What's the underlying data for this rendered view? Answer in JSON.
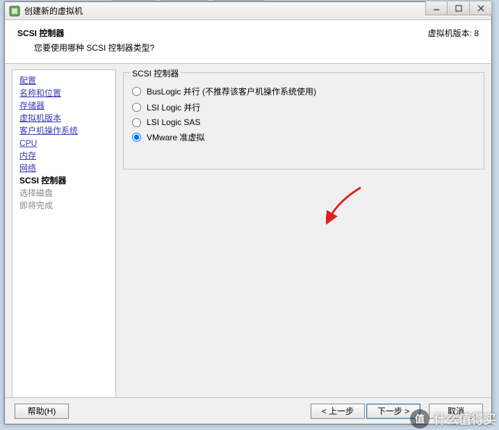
{
  "window": {
    "title": "创建新的虚拟机"
  },
  "header": {
    "title": "SCSI 控制器",
    "subtitle": "您要使用哪种 SCSI 控制器类型?",
    "version_label": "虚拟机版本: 8"
  },
  "sidebar": {
    "items": [
      {
        "label": "配置",
        "state": "link"
      },
      {
        "label": "名称和位置",
        "state": "link"
      },
      {
        "label": "存储器",
        "state": "link"
      },
      {
        "label": "虚拟机版本",
        "state": "link"
      },
      {
        "label": "客户机操作系统",
        "state": "link"
      },
      {
        "label": "CPU",
        "state": "link"
      },
      {
        "label": "内存",
        "state": "link"
      },
      {
        "label": "网络",
        "state": "link"
      },
      {
        "label": "SCSI 控制器",
        "state": "current"
      },
      {
        "label": "选择磁盘",
        "state": "disabled"
      },
      {
        "label": "即将完成",
        "state": "disabled"
      }
    ]
  },
  "main": {
    "group_title": "SCSI 控制器",
    "options": [
      {
        "label": "BusLogic 并行 (不推荐该客户机操作系统使用)",
        "enabled": true,
        "selected": false
      },
      {
        "label": "LSI Logic 并行",
        "enabled": true,
        "selected": false
      },
      {
        "label": "LSI Logic SAS",
        "enabled": true,
        "selected": false
      },
      {
        "label": "VMware 准虚拟",
        "enabled": true,
        "selected": true
      }
    ]
  },
  "footer": {
    "help": "帮助(H)",
    "back": "< 上一步",
    "next": "下一步 >",
    "cancel": "取消"
  },
  "watermark": {
    "text": "什么值得买"
  }
}
